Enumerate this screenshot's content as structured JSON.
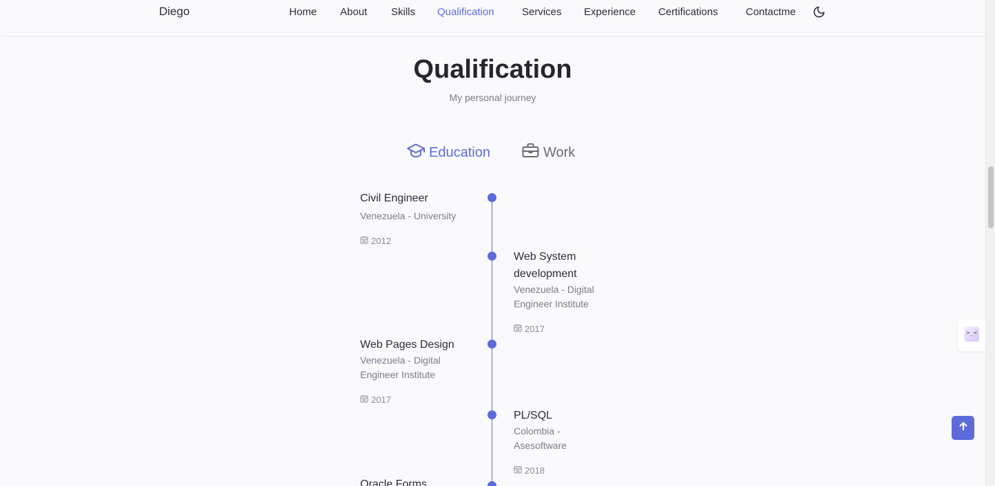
{
  "header": {
    "logo": "Diego",
    "nav": [
      {
        "label": "Home"
      },
      {
        "label": "About"
      },
      {
        "label": "Skills"
      },
      {
        "label": "Qualification",
        "active": true
      },
      {
        "label": "Services"
      },
      {
        "label": "Experience"
      },
      {
        "label": "Certifications"
      },
      {
        "label": "Contactme"
      }
    ],
    "theme_icon": "moon-icon"
  },
  "section": {
    "title": "Qualification",
    "subtitle": "My personal journey"
  },
  "tabs": {
    "education": {
      "label": "Education",
      "icon": "graduation-cap-icon",
      "active": true
    },
    "work": {
      "label": "Work",
      "icon": "briefcase-icon",
      "active": false
    }
  },
  "timeline": [
    {
      "title": "Civil Engineer",
      "subtitle": "Venezuela - University",
      "date": "2012",
      "side": "left"
    },
    {
      "title": "Web System development",
      "subtitle": "Venezuela - Digital Engineer Institute",
      "date": "2017",
      "side": "right"
    },
    {
      "title": "Web Pages Design",
      "subtitle": "Venezuela - Digital Engineer Institute",
      "date": "2017",
      "side": "left"
    },
    {
      "title": "PL/SQL",
      "subtitle": "Colombia - Asesoftware",
      "date": "2018",
      "side": "right"
    },
    {
      "title": "Oracle Forms",
      "subtitle": "",
      "date": "",
      "side": "left"
    }
  ],
  "widgets": {
    "extension_icon_text": ">_<",
    "scroll_up_icon": "arrow-up-icon"
  },
  "colors": {
    "accent": "#5c6bd9",
    "background": "#fafafd",
    "text": "#2b2b33",
    "muted": "#7a7a85"
  }
}
